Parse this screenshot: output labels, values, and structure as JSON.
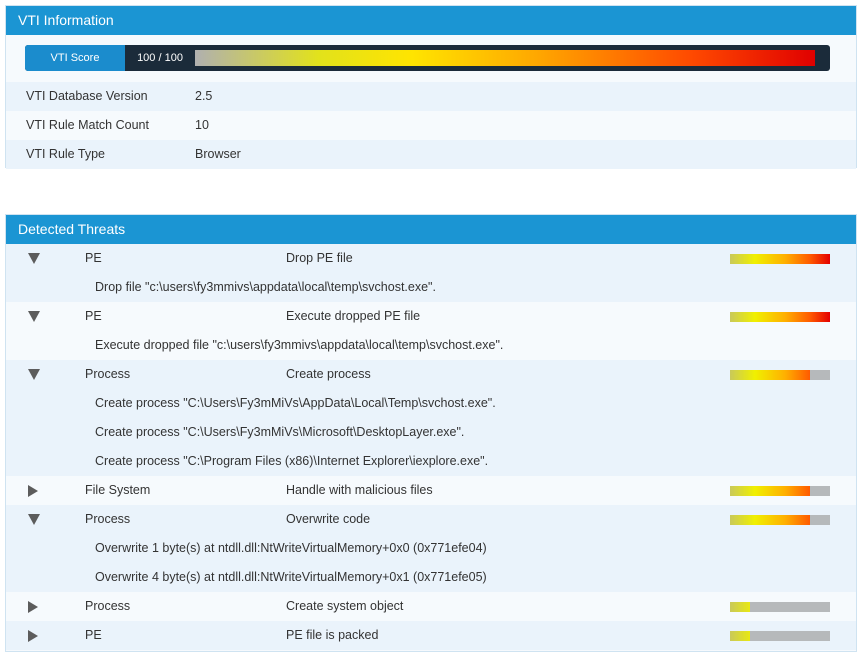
{
  "vti": {
    "title": "VTI Information",
    "score_label": "VTI Score",
    "score_value": "100 / 100",
    "rows": [
      {
        "key": "VTI Database Version",
        "value": "2.5"
      },
      {
        "key": "VTI Rule Match Count",
        "value": "10"
      },
      {
        "key": "VTI Rule Type",
        "value": "Browser"
      }
    ]
  },
  "threats": {
    "title": "Detected Threats",
    "items": [
      {
        "category": "PE",
        "classification": "Drop PE file",
        "severity": 1.0,
        "expanded": true,
        "details": [
          "Drop file \"c:\\users\\fy3mmivs\\appdata\\local\\temp\\svchost.exe\"."
        ]
      },
      {
        "category": "PE",
        "classification": "Execute dropped PE file",
        "severity": 1.0,
        "expanded": true,
        "details": [
          "Execute dropped file \"c:\\users\\fy3mmivs\\appdata\\local\\temp\\svchost.exe\"."
        ]
      },
      {
        "category": "Process",
        "classification": "Create process",
        "severity": 0.8,
        "expanded": true,
        "details": [
          "Create process \"C:\\Users\\Fy3mMiVs\\AppData\\Local\\Temp\\svchost.exe\".",
          "Create process \"C:\\Users\\Fy3mMiVs\\Microsoft\\DesktopLayer.exe\".",
          "Create process \"C:\\Program Files (x86)\\Internet Explorer\\iexplore.exe\"."
        ]
      },
      {
        "category": "File System",
        "classification": "Handle with malicious files",
        "severity": 0.8,
        "expanded": false,
        "details": []
      },
      {
        "category": "Process",
        "classification": "Overwrite code",
        "severity": 0.8,
        "expanded": true,
        "details": [
          "Overwrite 1 byte(s) at ntdll.dll:NtWriteVirtualMemory+0x0 (0x771efe04)",
          "Overwrite 4 byte(s) at ntdll.dll:NtWriteVirtualMemory+0x1 (0x771efe05)"
        ]
      },
      {
        "category": "Process",
        "classification": "Create system object",
        "severity": 0.2,
        "expanded": false,
        "details": []
      },
      {
        "category": "PE",
        "classification": "PE file is packed",
        "severity": 0.2,
        "expanded": false,
        "details": []
      }
    ]
  }
}
